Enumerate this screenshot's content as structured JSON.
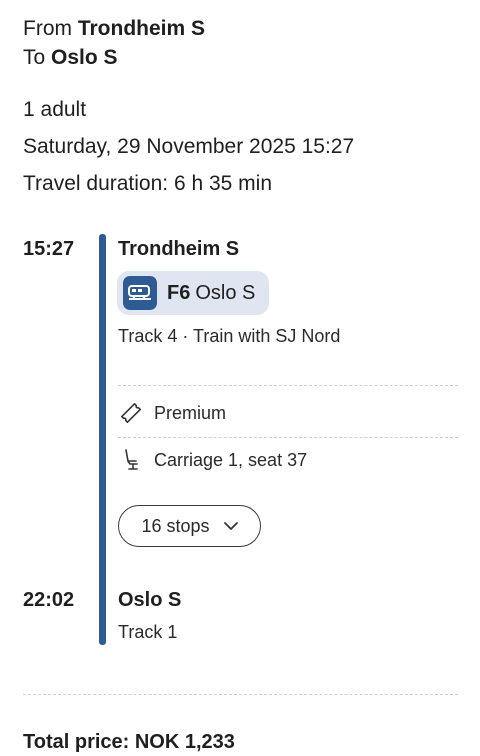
{
  "route": {
    "from_label": "From",
    "from_station": "Trondheim S",
    "to_label": "To",
    "to_station": "Oslo S"
  },
  "trip_info": {
    "passengers": "1 adult",
    "datetime": "Saturday, 29 November 2025 15:27",
    "duration": "Travel duration: 6 h 35 min"
  },
  "journey": {
    "departure": {
      "time": "15:27",
      "station": "Trondheim S"
    },
    "service": {
      "icon": "train-icon",
      "line": "F6",
      "destination": "Oslo S",
      "details": "Track 4 · Train with SJ Nord"
    },
    "ticket": {
      "class_icon": "ticket-icon",
      "class_label": "Premium",
      "seat_icon": "seat-icon",
      "seat_label": "Carriage 1, seat 37"
    },
    "stops_button": {
      "label": "16 stops",
      "icon": "chevron-down-icon"
    },
    "arrival": {
      "time": "22:02",
      "station": "Oslo S",
      "track": "Track 1"
    },
    "line_color": "#2f5b94"
  },
  "price": {
    "total": "Total price: NOK 1,233"
  }
}
